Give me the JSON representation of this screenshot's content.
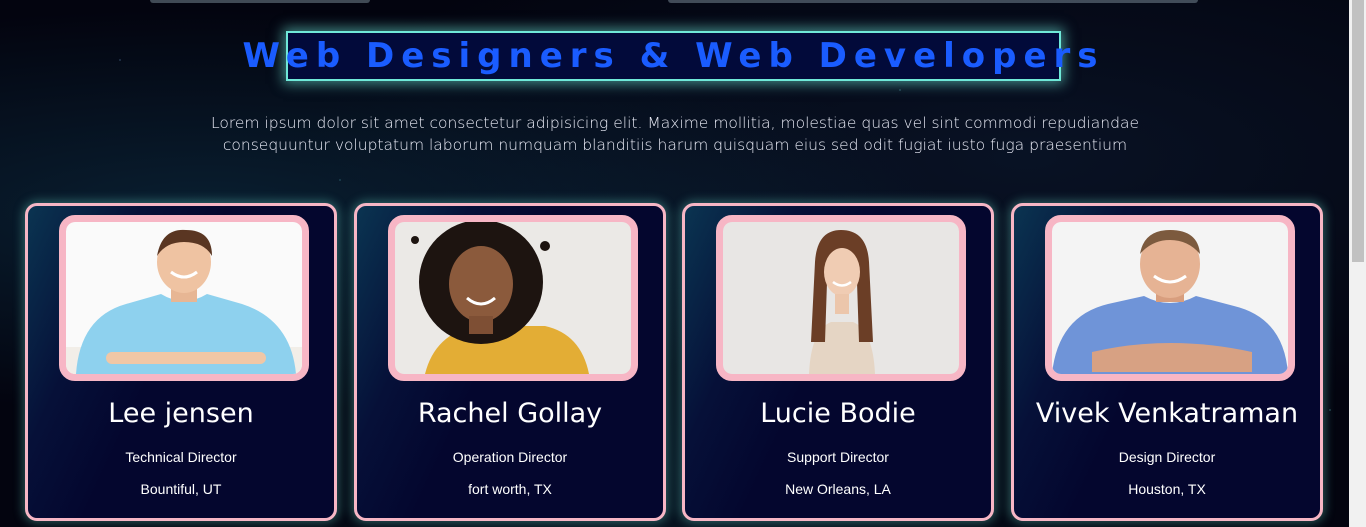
{
  "header": {
    "title": "Web Designers & Web Developers",
    "intro": "Lorem ipsum dolor sit amet consectetur adipisicing elit. Maxime mollitia, molestiae quas vel sint commodi repudiandae consequuntur voluptatum laborum numquam blanditiis harum quisquam eius sed odit fugiat iusto fuga praesentium"
  },
  "team": [
    {
      "name": "Lee jensen",
      "role": "Technical Director",
      "location": "Bountiful, UT"
    },
    {
      "name": "Rachel Gollay",
      "role": "Operation Director",
      "location": "fort worth, TX"
    },
    {
      "name": "Lucie Bodie",
      "role": "Support Director",
      "location": "New Orleans, LA"
    },
    {
      "name": "Vivek Venkatraman",
      "role": "Design Director",
      "location": "Houston, TX"
    }
  ],
  "colors": {
    "background": "#03040f",
    "title_text": "#1a5cff",
    "title_box": "#020a3a",
    "title_glow": "#6fe8d8",
    "card_border": "#f7b6c5",
    "card_bg": "#04062e"
  },
  "icons": {
    "photo_1": "man-light-blue-shirt-portrait",
    "photo_2": "woman-curly-hair-yellow-top-portrait",
    "photo_3": "woman-long-brown-hair-portrait",
    "photo_4": "man-blue-shirt-arms-crossed-portrait"
  }
}
